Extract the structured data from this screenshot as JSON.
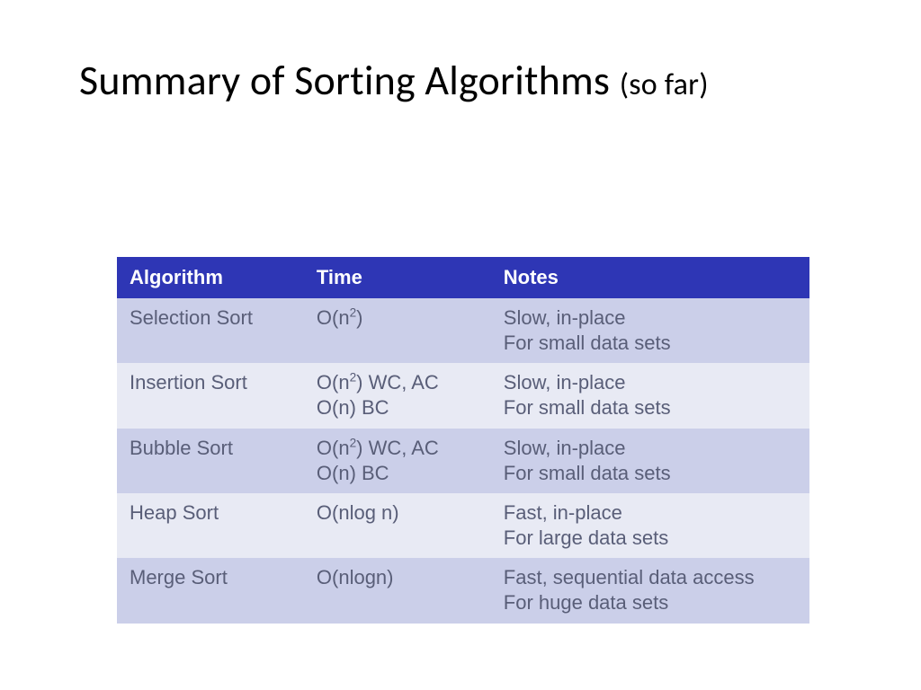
{
  "title": {
    "main": "Summary of Sorting Algorithms",
    "suffix": "(so far)"
  },
  "table": {
    "headers": [
      "Algorithm",
      "Time",
      "Notes"
    ],
    "rows": [
      {
        "algorithm": "Selection Sort",
        "time_lines": [
          {
            "prefix": "O(n",
            "sup": "2",
            "suffix": ")"
          }
        ],
        "notes_lines": [
          "Slow, in-place",
          "For small data sets"
        ]
      },
      {
        "algorithm": "Insertion Sort",
        "time_lines": [
          {
            "prefix": "O(n",
            "sup": "2",
            "suffix": ") WC, AC"
          },
          {
            "prefix": "O(n) BC",
            "sup": "",
            "suffix": ""
          }
        ],
        "notes_lines": [
          "Slow, in-place",
          "For small data sets"
        ]
      },
      {
        "algorithm": "Bubble Sort",
        "time_lines": [
          {
            "prefix": "O(n",
            "sup": "2",
            "suffix": ") WC, AC"
          },
          {
            "prefix": "O(n) BC",
            "sup": "",
            "suffix": ""
          }
        ],
        "notes_lines": [
          "Slow, in-place",
          "For small data sets"
        ]
      },
      {
        "algorithm": "Heap Sort",
        "time_lines": [
          {
            "prefix": "O(nlog n)",
            "sup": "",
            "suffix": ""
          }
        ],
        "notes_lines": [
          "Fast, in-place",
          "For large data sets"
        ]
      },
      {
        "algorithm": "Merge Sort",
        "time_lines": [
          {
            "prefix": "O(nlogn)",
            "sup": "",
            "suffix": ""
          }
        ],
        "notes_lines": [
          "Fast, sequential data access",
          "For huge data sets"
        ]
      }
    ]
  }
}
